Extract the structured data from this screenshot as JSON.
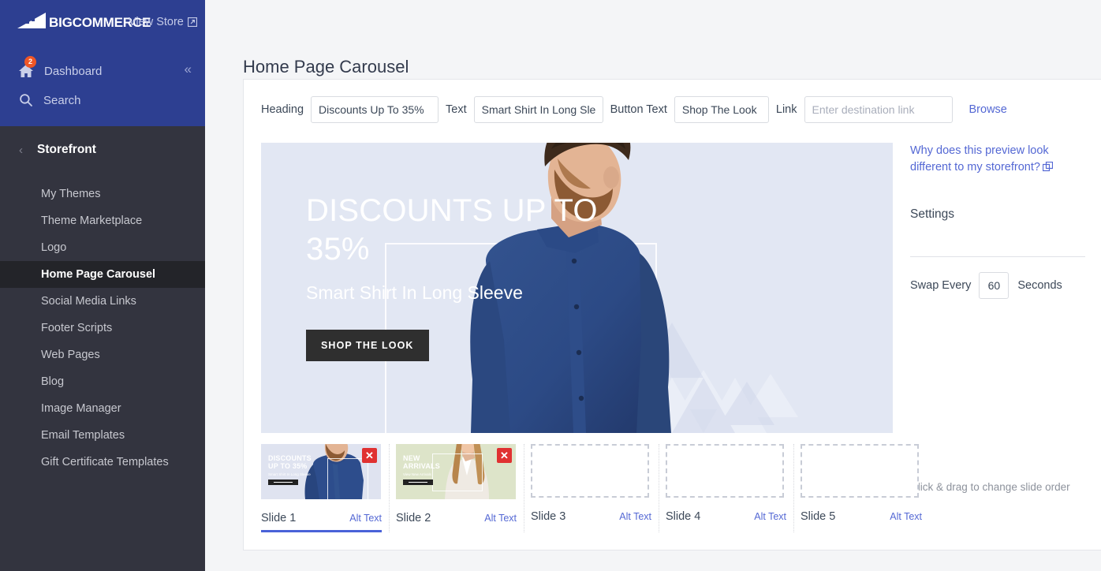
{
  "brand": {
    "logo_text": "BIGCOMMERCE",
    "view_store_label": "View Store",
    "view_store_icon": "external-link-icon"
  },
  "topnav": {
    "dashboard_label": "Dashboard",
    "dashboard_badge": "2",
    "search_label": "Search",
    "collapse_icon": "double-chevron-left-icon"
  },
  "sidebar": {
    "section_title": "Storefront",
    "back_icon": "chevron-left-icon",
    "items": [
      {
        "label": "My Themes",
        "active": false
      },
      {
        "label": "Theme Marketplace",
        "active": false
      },
      {
        "label": "Logo",
        "active": false
      },
      {
        "label": "Home Page Carousel",
        "active": true
      },
      {
        "label": "Social Media Links",
        "active": false
      },
      {
        "label": "Footer Scripts",
        "active": false
      },
      {
        "label": "Web Pages",
        "active": false
      },
      {
        "label": "Blog",
        "active": false
      },
      {
        "label": "Image Manager",
        "active": false
      },
      {
        "label": "Email Templates",
        "active": false
      },
      {
        "label": "Gift Certificate Templates",
        "active": false
      }
    ]
  },
  "page": {
    "title": "Home Page Carousel"
  },
  "form": {
    "heading_label": "Heading",
    "heading_value": "Discounts Up To 35%",
    "text_label": "Text",
    "text_value": "Smart Shirt In Long Sleeve",
    "button_text_label": "Button Text",
    "button_text_value": "Shop The Look",
    "link_label": "Link",
    "link_value": "",
    "link_placeholder": "Enter destination link",
    "browse_label": "Browse"
  },
  "preview": {
    "heading": "DISCOUNTS UP TO 35%",
    "text": "Smart Shirt In Long Sleeve",
    "button": "SHOP THE LOOK",
    "background_color": "#E2E7F3"
  },
  "settings": {
    "why_link": "Why does this preview look different to my storefront?",
    "why_icon": "popout-window-icon",
    "title": "Settings",
    "swap_label": "Swap Every",
    "swap_value": "60",
    "swap_unit": "Seconds",
    "drag_hint": "Click & drag to change slide order"
  },
  "slides": [
    {
      "name": "Slide 1",
      "alt_label": "Alt Text",
      "filled": true,
      "selected": true,
      "thumb_heading": "DISCOUNTS UP TO 35%",
      "thumb_sub": "Smart Shirt In Long Sleeve",
      "delete_icon": "close-icon",
      "bg": "#DFE3F0"
    },
    {
      "name": "Slide 2",
      "alt_label": "Alt Text",
      "filled": true,
      "selected": false,
      "thumb_heading": "NEW ARRIVALS",
      "thumb_sub": "View New Arrivals",
      "delete_icon": "close-icon",
      "bg": "#DDE4C9"
    },
    {
      "name": "Slide 3",
      "alt_label": "Alt Text",
      "filled": false,
      "selected": false
    },
    {
      "name": "Slide 4",
      "alt_label": "Alt Text",
      "filled": false,
      "selected": false
    },
    {
      "name": "Slide 5",
      "alt_label": "Alt Text",
      "filled": false,
      "selected": false
    }
  ],
  "colors": {
    "brand_blue": "#2D3F91",
    "sidebar_dark": "#33343F",
    "sidebar_active": "#232429",
    "link_blue": "#5468D4",
    "badge_orange": "#EF5626",
    "delete_red": "#E03131"
  }
}
